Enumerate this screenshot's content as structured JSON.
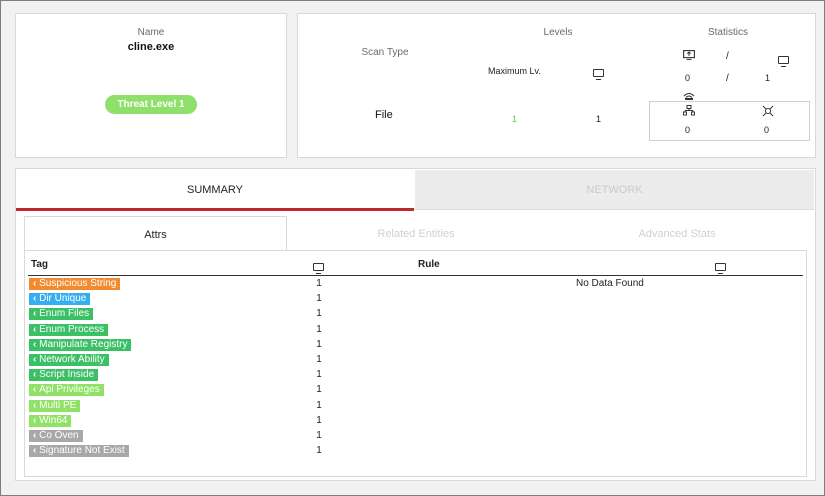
{
  "file_card": {
    "name_label": "Name",
    "file_name": "cline.exe",
    "threat_badge": "Threat Level 1",
    "threat_color": "#8ee06a"
  },
  "levels_card": {
    "levels_header": "Levels",
    "statistics_header": "Statistics",
    "scan_type_label": "Scan Type",
    "max_level_label": "Maximum Lv.",
    "scan_type_value": "File",
    "max_level_value": "1",
    "device_level_value": "1",
    "stats": {
      "top_left_value": "0",
      "separator": "/",
      "top_right_value": "1",
      "bottom_left_value": "0",
      "bottom_right_value": "0"
    },
    "icons": [
      "upload-monitor-icon",
      "monitor-icon",
      "network-tree-icon",
      "virus-icon",
      "signal-icon"
    ]
  },
  "main_tabs": [
    {
      "label": "SUMMARY",
      "active": true
    },
    {
      "label": "NETWORK",
      "active": false
    }
  ],
  "sub_tabs": [
    {
      "label": "Attrs",
      "active": true
    },
    {
      "label": "Related Entities",
      "active": false
    },
    {
      "label": "Advanced Stats",
      "active": false
    }
  ],
  "table": {
    "tag_header": "Tag",
    "rule_header": "Rule",
    "empty_message": "No Data Found",
    "rows": [
      {
        "tag": "Suspicious String",
        "count": "1",
        "color": "#f28a30"
      },
      {
        "tag": "Dir Unique",
        "count": "1",
        "color": "#35aff0"
      },
      {
        "tag": "Enum Files",
        "count": "1",
        "color": "#3cc065"
      },
      {
        "tag": "Enum Process",
        "count": "1",
        "color": "#3cc065"
      },
      {
        "tag": "Manipulate Registry",
        "count": "1",
        "color": "#3cc065"
      },
      {
        "tag": "Network Ability",
        "count": "1",
        "color": "#3cc065"
      },
      {
        "tag": "Script Inside",
        "count": "1",
        "color": "#3cc065"
      },
      {
        "tag": "Api Privileges",
        "count": "1",
        "color": "#8fe265"
      },
      {
        "tag": "Multi PE",
        "count": "1",
        "color": "#8fe265"
      },
      {
        "tag": "Win64",
        "count": "1",
        "color": "#8fe265"
      },
      {
        "tag": "Co Oven",
        "count": "1",
        "color": "#a8a8a8"
      },
      {
        "tag": "Signature Not Exist",
        "count": "1",
        "color": "#a8a8a8"
      }
    ]
  },
  "colors": {
    "accent_red": "#c0282f",
    "level_green": "#5bc95b"
  }
}
